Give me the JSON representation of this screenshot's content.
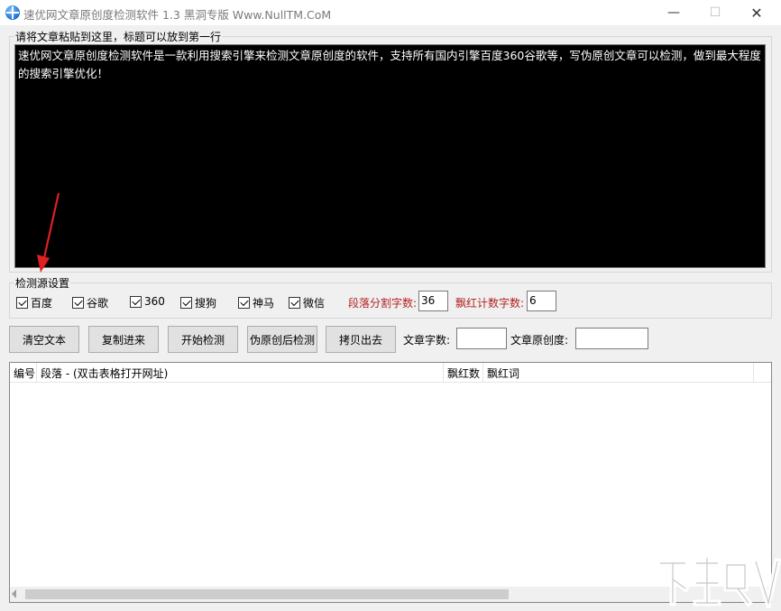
{
  "window": {
    "title": "速优网文章原创度检测软件 1.3    黑洞专版 Www.NullTM.CoM",
    "minimize_glyph": "—",
    "maximize_glyph": "☐",
    "close_glyph": "✕"
  },
  "article": {
    "legend": "请将文章粘贴到这里，标题可以放到第一行",
    "text": "速优网文章原创度检测软件是一款利用搜索引擎来检测文章原创度的软件，支持所有国内引擎百度360谷歌等，写伪原创文章可以检测，做到最大程度的搜索引擎优化！"
  },
  "source_settings": {
    "legend": "检测源设置",
    "checkboxes": [
      {
        "label": "百度",
        "checked": true
      },
      {
        "label": "谷歌",
        "checked": true
      },
      {
        "label": "360",
        "checked": true
      },
      {
        "label": "搜狗",
        "checked": true
      },
      {
        "label": "神马",
        "checked": true
      },
      {
        "label": "微信",
        "checked": true
      }
    ],
    "segment_label": "段落分割字数:",
    "segment_value": "36",
    "red_count_label": "飘红计数字数:",
    "red_count_value": "6"
  },
  "toolbar": {
    "clear_label": "清空文本",
    "paste_label": "复制进来",
    "start_label": "开始检测",
    "pseudo_label": "伪原创后检测",
    "copy_out_label": "拷贝出去",
    "word_count_label": "文章字数:",
    "word_count_value": "",
    "originality_label": "文章原创度:",
    "originality_value": ""
  },
  "results": {
    "columns": [
      "编号",
      "段落 - (双击表格打开网址)",
      "飘红数",
      "飘红词"
    ],
    "rows": []
  },
  "colors": {
    "accent_red": "#b22222",
    "editor_bg": "#000000",
    "editor_fg": "#ffffff"
  },
  "icons": {
    "app": "globe-icon",
    "annotation": "red-arrow-icon",
    "watermark": "xiazaiba-watermark-icon"
  }
}
